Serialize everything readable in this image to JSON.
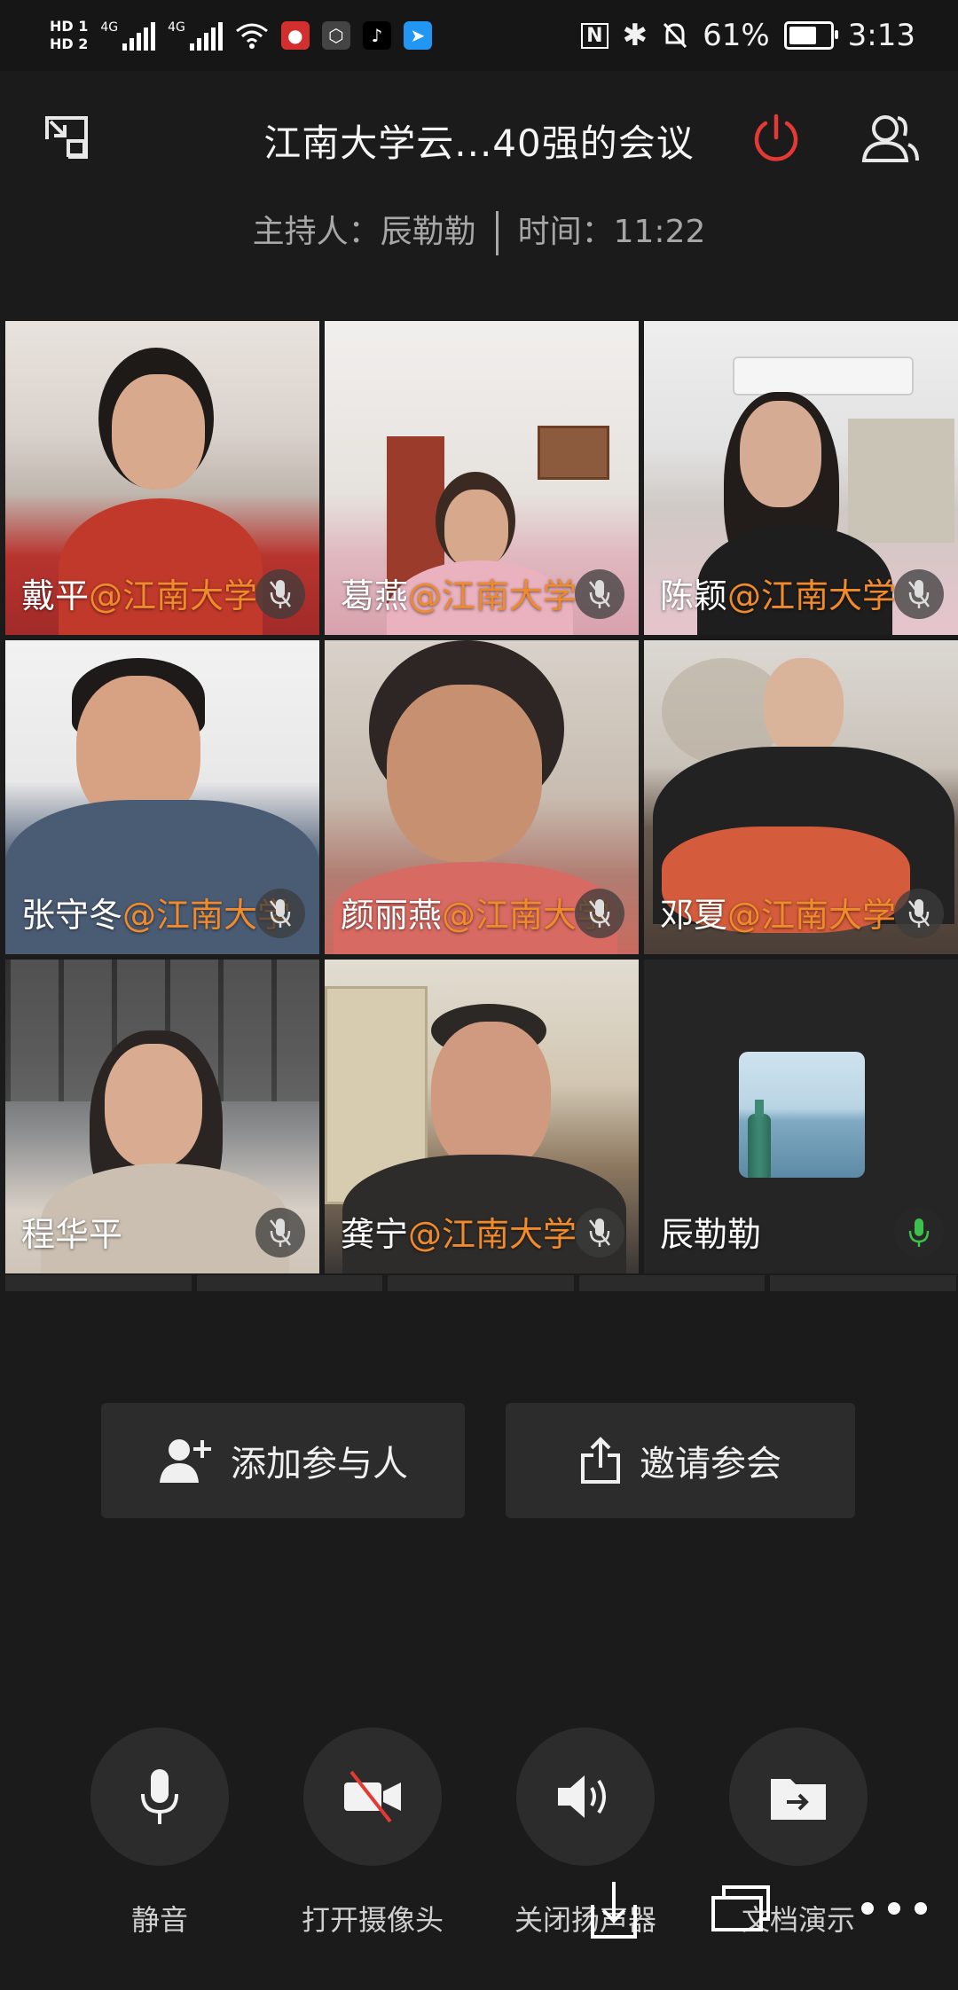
{
  "status_bar": {
    "hd1": "HD 1",
    "hd2": "HD 2",
    "net1": "4G",
    "net2": "4G",
    "battery": "61%",
    "time": "3:13"
  },
  "header": {
    "title": "江南大学云...40强的会议",
    "host_label": "主持人：辰勒勒",
    "time_label": "时间：11:22"
  },
  "participants": [
    {
      "name": "戴平",
      "org": "@江南大学"
    },
    {
      "name": "葛燕",
      "org": "@江南大学"
    },
    {
      "name": "陈颖",
      "org": "@江南大学"
    },
    {
      "name": "张守冬",
      "org": "@江南大学"
    },
    {
      "name": "颜丽燕",
      "org": "@江南大学"
    },
    {
      "name": "邓夏",
      "org": "@江南大学"
    },
    {
      "name": "程华平",
      "org": ""
    },
    {
      "name": "龚宁",
      "org": "@江南大学"
    },
    {
      "name": "辰勒勒",
      "org": ""
    }
  ],
  "actions": {
    "add_participant": "添加参与人",
    "invite": "邀请参会"
  },
  "toolbar": {
    "mute": "静音",
    "camera": "打开摄像头",
    "speaker": "关闭扬声器",
    "doc": "文档演示"
  },
  "colors": {
    "accent_org": "#f08a2a",
    "leave_red": "#e53935",
    "mic_green": "#3cc24a"
  }
}
